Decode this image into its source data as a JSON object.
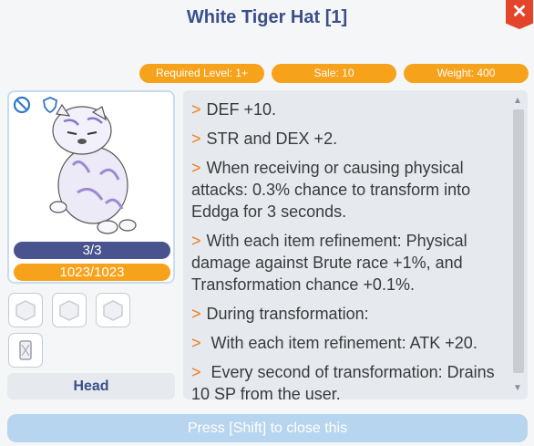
{
  "header": {
    "title": "White Tiger Hat [1]",
    "close_label": "✕"
  },
  "stats": {
    "required_level": "Required Level: 1+",
    "sale": "Sale: 10",
    "weight": "Weight: 400"
  },
  "item_card": {
    "refine": "3/3",
    "durability": "1023/1023",
    "icons": [
      "no-trade-icon",
      "shield-icon"
    ],
    "slot_count": 4,
    "slot_type": "Head"
  },
  "description": {
    "bullet": ">",
    "lines": [
      "DEF +10.",
      "STR and DEX +2.",
      "When receiving or causing physical attacks: 0.3% chance to transform into Eddga for 3 seconds.",
      "With each item refinement: Physical damage against Brute race +1%, and Transformation chance +0.1%.",
      "During transformation:",
      " With each item refinement: ATK +20.",
      " Every second of transformation: Drains 10 SP from the user."
    ]
  },
  "footer": {
    "close_hint": "Press [Shift] to close this"
  },
  "colors": {
    "accent_orange": "#f7a21b",
    "title_blue": "#3b4f8a",
    "bullet_orange": "#f07d1c",
    "close_red": "#e2452a"
  }
}
